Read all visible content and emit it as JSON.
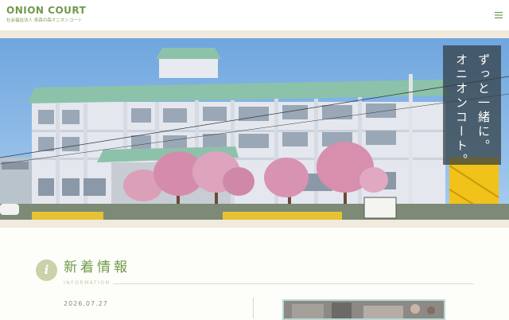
{
  "header": {
    "logo_title": "ONION COURT",
    "logo_subtitle": "社会福祉法人 青森の森オニオンコート",
    "menu_icon": "hamburger-menu-icon"
  },
  "hero": {
    "tagline_line1": "ずっと一緒に。",
    "tagline_line2": "オニオンコート。"
  },
  "news": {
    "icon_letter": "i",
    "title": "新着情報",
    "title_en": "INFORMATION",
    "items": [
      {
        "date": "2026.07.27"
      }
    ]
  },
  "colors": {
    "brand_green": "#6e9a4a",
    "accent_sage": "#c9d2a9",
    "band_beige": "#f1eadf",
    "thumb_border": "#b9d8d3"
  }
}
